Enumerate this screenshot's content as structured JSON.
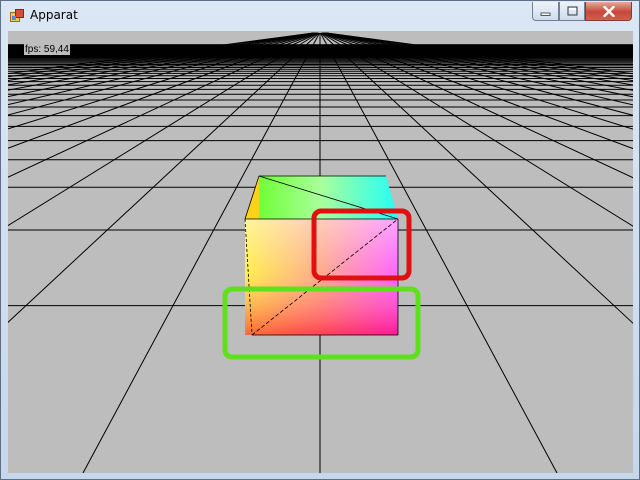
{
  "window": {
    "title": "Apparat",
    "icon": "app-window-icon"
  },
  "controls": {
    "minimize_icon": "minimize-icon",
    "maximize_icon": "maximize-icon",
    "close_icon": "close-icon"
  },
  "viewport": {
    "fps_label": "fps: 59,44",
    "background": "#bdbdbd",
    "grid_color": "#000000"
  },
  "annotations": {
    "highlight_1_color": "#e01010",
    "highlight_2_color": "#5ee01a"
  }
}
